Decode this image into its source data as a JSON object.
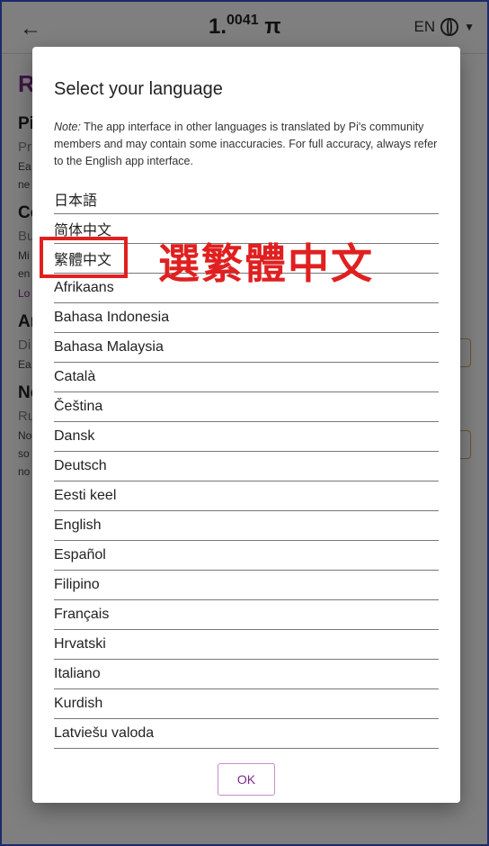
{
  "header": {
    "back_icon": "arrow-left-icon",
    "balance_main": "1.",
    "balance_sup": "0041",
    "balance_unit": " π",
    "language_code": "EN"
  },
  "background_page": {
    "title": "R",
    "sections": [
      {
        "heading": "Pi",
        "sub": "Pr",
        "lines": [
          "Ea",
          "ne"
        ]
      },
      {
        "heading": "Co",
        "sub": "Bu",
        "lines": [
          "Mi",
          "en"
        ],
        "link": "Lo"
      },
      {
        "heading": "Ar",
        "sub": "Di",
        "lines": [
          "Ea"
        ]
      },
      {
        "heading": "No",
        "sub": "Ru",
        "lines": [
          "No",
          "so",
          "no"
        ]
      }
    ]
  },
  "dialog": {
    "title": "Select your language",
    "note_label": "Note:",
    "note_text": " The app interface in other languages is translated by Pi's community members and may contain some inaccuracies. For full accuracy, always refer to the English app interface.",
    "languages": [
      "日本語",
      "简体中文",
      "繁體中文",
      "Afrikaans",
      "Bahasa Indonesia",
      "Bahasa Malaysia",
      "Català",
      "Čeština",
      "Dansk",
      "Deutsch",
      "Eesti keel",
      "English",
      "Español",
      "Filipino",
      "Français",
      "Hrvatski",
      "Italiano",
      "Kurdish",
      "Latviešu valoda"
    ],
    "ok_label": "OK"
  },
  "annotation": {
    "text": "選繁體中文",
    "color": "#e02020"
  }
}
